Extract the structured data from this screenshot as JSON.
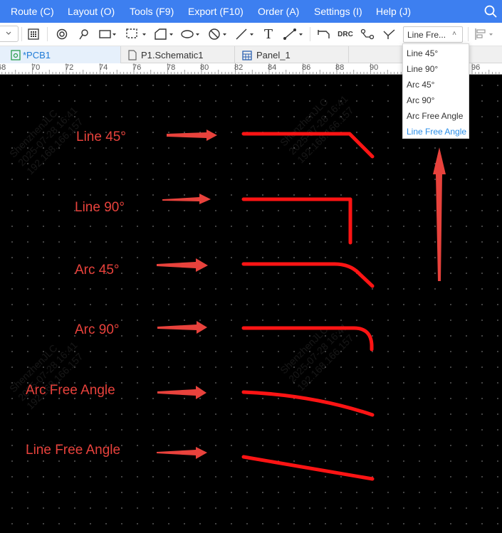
{
  "menubar": {
    "items": [
      "Route (C)",
      "Layout (O)",
      "Tools (F9)",
      "Export (F10)",
      "Order (A)",
      "Settings (I)",
      "Help (J)"
    ],
    "search_icon": "search-icon",
    "color": "#3d7ff0"
  },
  "toolbar": {
    "icons": [
      "grid-icon",
      "via-icon",
      "pad-icon",
      "rect-select-icon",
      "dashed-rect-icon",
      "polygon-icon",
      "no-entry-icon",
      "ellipse-icon",
      "line-icon",
      "text-icon",
      "dimension-icon",
      "route-icon",
      "drc-icon",
      "node-icon",
      "branch-icon",
      "align-icon"
    ],
    "drc_label": "DRC",
    "text_tool_label": "T",
    "routing_mode_select": "Line Fre..."
  },
  "tabs": [
    {
      "label": "*PCB1",
      "icon": "pcb-icon",
      "active": true
    },
    {
      "label": "P1.Schematic1",
      "icon": "schematic-icon",
      "active": false
    },
    {
      "label": "Panel_1",
      "icon": "panel-icon",
      "active": false
    }
  ],
  "ruler": {
    "labels": [
      "68",
      "70",
      "72",
      "74",
      "76",
      "78",
      "80",
      "82",
      "84",
      "86",
      "88",
      "90",
      "96"
    ]
  },
  "dropdown": {
    "options": [
      "Line 45°",
      "Line 90°",
      "Arc 45°",
      "Arc 90°",
      "Arc Free Angle",
      "Line Free Angle"
    ],
    "selected": "Line Free Angle",
    "selected_color": "#2a8ee8"
  },
  "canvas": {
    "labels": [
      "Line 45°",
      "Line 90°",
      "Arc 45°",
      "Arc 90°",
      "Arc Free Angle",
      "Line Free Angle"
    ],
    "annotation_color": "#e8423c",
    "trace_color": "#ff1414",
    "watermark_lines": [
      "ShenzhenJLC",
      "2025-07-28 16:41",
      "192.168.166.157"
    ]
  }
}
